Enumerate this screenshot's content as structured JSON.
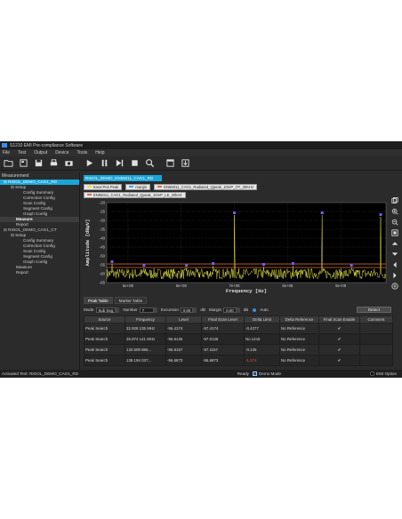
{
  "window": {
    "title": "S1210 EMI Pre-compliance Software"
  },
  "menu": [
    "File",
    "Test",
    "Output",
    "Device",
    "Tools",
    "Help"
  ],
  "toolbar": {
    "icons": [
      "open-folder-icon",
      "new-icon",
      "save-icon",
      "print-icon",
      "camera-icon",
      "play-icon",
      "pause-icon",
      "step-icon",
      "stop-icon",
      "search-icon",
      "window-icon",
      "export-icon"
    ]
  },
  "tree": {
    "title": "Measurement",
    "nodes": [
      {
        "label": "RIGOL_DEMO_CAG1_RD",
        "indent": 4,
        "prefix": "⊟",
        "state": "selected"
      },
      {
        "label": "Setup",
        "indent": 12,
        "prefix": "⊟",
        "state": ""
      },
      {
        "label": "Config Summary",
        "indent": 26,
        "prefix": "",
        "state": ""
      },
      {
        "label": "Correction Config",
        "indent": 26,
        "prefix": "",
        "state": ""
      },
      {
        "label": "Scan Config",
        "indent": 26,
        "prefix": "",
        "state": ""
      },
      {
        "label": "Segment Config",
        "indent": 26,
        "prefix": "",
        "state": ""
      },
      {
        "label": "Graph Config",
        "indent": 26,
        "prefix": "",
        "state": ""
      },
      {
        "label": "Measure",
        "indent": 18,
        "prefix": "",
        "state": "highlight"
      },
      {
        "label": "Report",
        "indent": 18,
        "prefix": "",
        "state": ""
      },
      {
        "label": "RIGOL_DEMO_CAG1_CT",
        "indent": 4,
        "prefix": "⊟",
        "state": ""
      },
      {
        "label": "Setup",
        "indent": 12,
        "prefix": "⊟",
        "state": ""
      },
      {
        "label": "Config Summary",
        "indent": 26,
        "prefix": "",
        "state": ""
      },
      {
        "label": "Correction Config",
        "indent": 26,
        "prefix": "",
        "state": ""
      },
      {
        "label": "Scan Config",
        "indent": 26,
        "prefix": "",
        "state": ""
      },
      {
        "label": "Segment Config",
        "indent": 26,
        "prefix": "",
        "state": ""
      },
      {
        "label": "Graph Config",
        "indent": 26,
        "prefix": "",
        "state": ""
      },
      {
        "label": "Measure",
        "indent": 18,
        "prefix": "",
        "state": ""
      },
      {
        "label": "Report",
        "indent": 18,
        "prefix": "",
        "state": ""
      }
    ]
  },
  "main": {
    "active_tab": "RIGOL_DEMO_EN55011_CAG1_RD",
    "legend_row1": [
      {
        "label": "trace:Pos Peak",
        "color": "#e0e040"
      },
      {
        "label": "margin",
        "color": "#4aa0e0"
      },
      {
        "label": "EN55011_CAG1_Radiated_Qpeak_10mP_OT_30KHz",
        "color": "#e07030"
      }
    ],
    "legend_row2": [
      {
        "label": "EN55011_CAG1_Radiated_Qpeak_10mP_LE_20kHz",
        "color": "#e07030"
      }
    ]
  },
  "chart_data": {
    "type": "line",
    "xlabel": "Frequency [Hz]",
    "ylabel": "Amplitude [dBµV]",
    "x_ticks": [
      "5e+08",
      "6e+08",
      "7e+08",
      "8e+08",
      "9e+08"
    ],
    "y_ticks": [
      "-20",
      "-25",
      "-30",
      "-35",
      "-40",
      "-45",
      "-50",
      "-55",
      "-60",
      "-65"
    ],
    "ylim": [
      -65,
      -20
    ],
    "xlim": [
      460,
      985
    ],
    "grid": true,
    "limit_lines": [
      -54.5,
      -56.5
    ],
    "noise_center": -60,
    "noise_spread": 3,
    "peaks": [
      {
        "x": 470,
        "y": -54.5
      },
      {
        "x": 530,
        "y": -56.5
      },
      {
        "x": 610,
        "y": -56.5
      },
      {
        "x": 660,
        "y": -55.5
      },
      {
        "x": 700,
        "y": -27
      },
      {
        "x": 755,
        "y": -56
      },
      {
        "x": 810,
        "y": -55.5
      },
      {
        "x": 865,
        "y": -27
      },
      {
        "x": 920,
        "y": -56.5
      },
      {
        "x": 975,
        "y": -28
      }
    ],
    "trace_color": "#e0e040",
    "limit_color": "#e07030",
    "marker_color": "#7a5cff"
  },
  "bottom_tabs": [
    "Peak Table",
    "Marker Table"
  ],
  "controls": {
    "mode_label": "Mode",
    "mode_value": "Sub Seg",
    "number_label": "Number",
    "number_value": "7",
    "excursion_label": "Excursion",
    "excursion_value": "0.00",
    "excursion_unit": "dB",
    "margin_label": "Margin",
    "margin_value": "0.00",
    "margin_unit": "dB",
    "auto_label": "Auto",
    "detect_label": "Detect"
  },
  "table": {
    "headers": [
      "Source",
      "Frequency",
      "Level",
      "Final Scan Level",
      "Delta Limit",
      "Delta Reference",
      "Final Scan Enable",
      "Comment"
    ],
    "rows": [
      [
        "Peak Search",
        "32.928 135 MHz",
        "-56.4174",
        "-57.4174",
        "-0.4277",
        "No Reference",
        "✔",
        ""
      ],
      [
        "Peak Search",
        "26.974 141 MHz",
        "-56.6126",
        "-57.0126",
        "No Limit",
        "No Reference",
        "✔",
        ""
      ],
      [
        "Peak Search",
        "132.509 866...",
        "-56.6157",
        "-57.1157",
        "-0.126",
        "No Reference",
        "✔",
        ""
      ],
      [
        "Peak Search",
        "139.194 037...",
        "-56.6873",
        "-56.6873",
        "-1.374",
        "No Reference",
        "✔",
        ""
      ]
    ]
  },
  "status": {
    "left": "Activated Test:  RIGOL_DEMO_CAG1_RD",
    "ready": "Ready",
    "demo": "Demo Mode",
    "emi": "EMI Option"
  }
}
